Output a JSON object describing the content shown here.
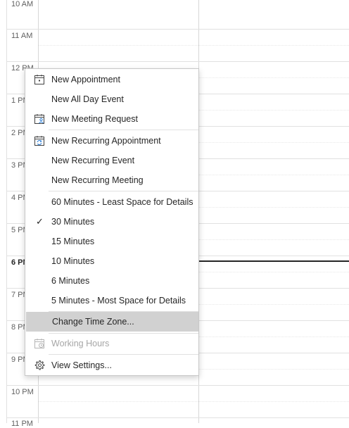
{
  "calendar": {
    "times": [
      "10 AM",
      "11 AM",
      "12 PM",
      "1 PM",
      "2 PM",
      "3 PM",
      "4 PM",
      "5 PM",
      "6 PM",
      "7 PM",
      "8 PM",
      "9 PM",
      "10 PM",
      "11 PM"
    ],
    "current_time_label": "6 PM"
  },
  "menu": {
    "items": [
      {
        "label": "New Appointment",
        "icon": "calendar-appointment-icon"
      },
      {
        "label": "New All Day Event"
      },
      {
        "label": "New Meeting Request",
        "icon": "meeting-request-icon"
      },
      {
        "label": "New Recurring Appointment",
        "icon": "recurring-appointment-icon"
      },
      {
        "label": "New Recurring Event"
      },
      {
        "label": "New Recurring Meeting"
      },
      {
        "label": "60 Minutes - Least Space for Details"
      },
      {
        "label": "30 Minutes",
        "checked": true,
        "check_glyph": "✓"
      },
      {
        "label": "15 Minutes"
      },
      {
        "label": "10 Minutes"
      },
      {
        "label": "6 Minutes"
      },
      {
        "label": "5 Minutes - Most Space for Details"
      },
      {
        "label": "Change Time Zone...",
        "highlighted": true
      },
      {
        "label": "Working Hours",
        "icon": "working-hours-icon",
        "disabled": true
      },
      {
        "label": "View Settings...",
        "icon": "gear-icon"
      }
    ]
  },
  "colors": {
    "highlight": "#d1d1d1",
    "disabled_text": "#a6a6a6",
    "recurring_arrow": "#2b7cd3"
  }
}
